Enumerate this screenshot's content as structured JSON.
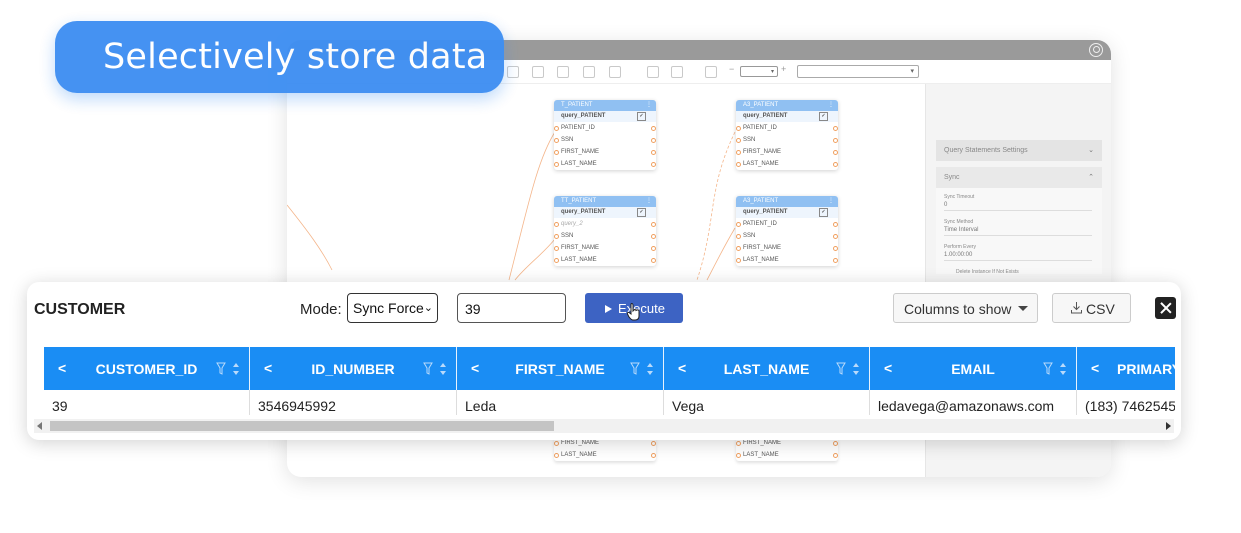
{
  "badge": {
    "text": "Selectively store data"
  },
  "background_app": {
    "zoom_value": "",
    "right_panel": {
      "section_1": "Query Statements Settings",
      "section_2": "Sync",
      "sync_timeout_label": "Sync Timeout",
      "sync_timeout_value": "0",
      "sync_method_label": "Sync Method",
      "sync_method_value": "Time Interval",
      "perform_every_label": "Perform Every",
      "perform_every_value": "1.00:00:00",
      "delete_instance_label": "Delete Instance If Not Exists"
    },
    "nodes": [
      {
        "title": "T_PATIENT",
        "query": "query_PATIENT",
        "rows": [
          "PATIENT_ID",
          "SSN",
          "FIRST_NAME",
          "LAST_NAME"
        ]
      },
      {
        "title": "A3_PATIENT",
        "query": "query_PATIENT",
        "rows": [
          "PATIENT_ID",
          "SSN",
          "FIRST_NAME",
          "LAST_NAME"
        ]
      },
      {
        "title": "TT_PATIENT",
        "query": "query_PATIENT",
        "query2": "query_2",
        "rows": [
          "SSN",
          "FIRST_NAME",
          "LAST_NAME"
        ]
      },
      {
        "title": "A3_PATIENT",
        "query": "query_PATIENT",
        "rows": [
          "PATIENT_ID",
          "SSN",
          "FIRST_NAME",
          "LAST_NAME"
        ]
      },
      {
        "rows": [
          "FIRST_NAME",
          "LAST_NAME"
        ]
      },
      {
        "rows": [
          "FIRST_NAME",
          "LAST_NAME"
        ]
      }
    ]
  },
  "panel": {
    "title": "CUSTOMER",
    "mode_label": "Mode:",
    "mode_value": "Sync Force",
    "input_value": "39",
    "execute_label": "Execute",
    "columns_label": "Columns to show",
    "csv_label": "CSV",
    "columns": [
      "CUSTOMER_ID",
      "ID_NUMBER",
      "FIRST_NAME",
      "LAST_NAME",
      "EMAIL",
      "PRIMARY"
    ],
    "row": [
      "39",
      "3546945992",
      "Leda",
      "Vega",
      "ledavega@amazonaws.com",
      "(183) 7462545"
    ],
    "scroll_fraction": 0.45
  },
  "colors": {
    "header": "#1a8df4",
    "execute": "#3d63c3",
    "badge": "#3f8ff2"
  }
}
